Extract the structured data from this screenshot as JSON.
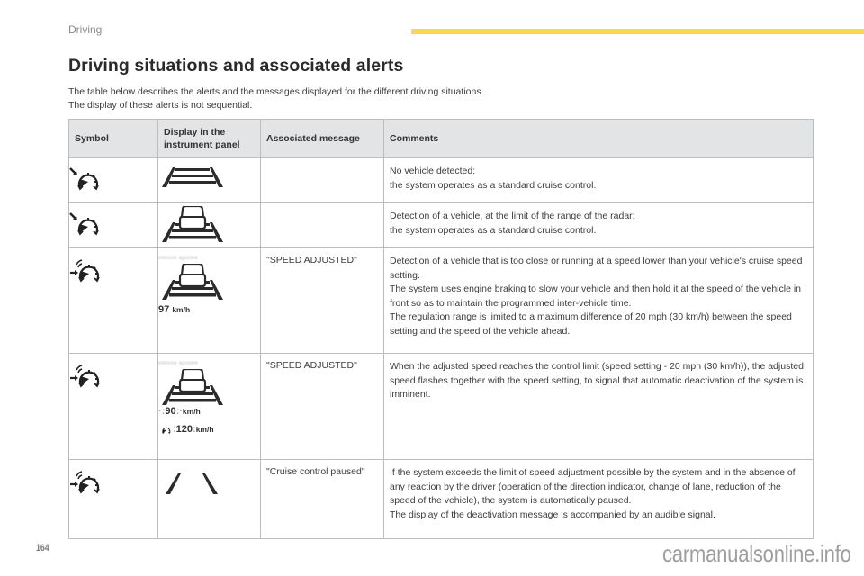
{
  "header": {
    "section": "Driving",
    "accent_color": "#ffd54f"
  },
  "title": "Driving situations and associated alerts",
  "intro": [
    "The table below describes the alerts and the messages displayed for the different driving situations.",
    "The display of these alerts is not sequential."
  ],
  "table": {
    "columns": [
      "Symbol",
      "Display in the instrument panel",
      "Associated message",
      "Comments"
    ],
    "header_bg": "#e3e4e6",
    "rows": [
      {
        "symbol_icon": "cruise-control-standard-icon",
        "display_icon": "road-lanes-icon",
        "display_text": "",
        "display_speed": "",
        "message": "",
        "comments": [
          "No vehicle detected:",
          "the system operates as a standard cruise control."
        ]
      },
      {
        "symbol_icon": "cruise-control-standard-icon",
        "display_icon": "road-lanes-vehicle-icon",
        "display_text": "",
        "display_speed": "",
        "message": "",
        "comments": [
          "Detection of a vehicle, at the limit of the range of the radar:",
          "the system operates as a standard cruise control."
        ]
      },
      {
        "symbol_icon": "adaptive-cruise-control-icon",
        "display_icon": "road-lanes-vehicle-icon",
        "display_text": "vitesse ajustée",
        "display_speed": "97",
        "display_unit": "km/h",
        "message": "\"SPEED ADJUSTED\"",
        "comments": [
          "Detection of a vehicle that is too close or running at a speed lower than your vehicle's cruise speed setting.",
          "The system uses engine braking to slow your vehicle and then hold it at the speed of the vehicle in front so as to maintain the programmed inter-vehicle time.",
          "The regulation range is limited to a maximum difference of 20 mph (30 km/h) between the speed setting and the speed of the vehicle ahead."
        ]
      },
      {
        "symbol_icon": "adaptive-cruise-control-icon",
        "display_icon": "road-lanes-vehicle-icon",
        "display_text": "vitesse ajustée",
        "display_speed": "90",
        "display_unit": "km/h",
        "display_setting_speed": "120",
        "message": "\"SPEED ADJUSTED\"",
        "comments": [
          "When the adjusted speed reaches the control limit (speed setting - 20 mph (30 km/h)), the adjusted speed flashes together with the speed setting, to signal that automatic deactivation of the system is imminent."
        ]
      },
      {
        "symbol_icon": "adaptive-cruise-control-icon",
        "display_icon": "lane-lines-icon",
        "display_text": "",
        "display_speed": "",
        "message": "\"Cruise control paused\"",
        "comments": [
          "If the system exceeds the limit of speed adjustment possible by the system and in the absence of any reaction by the driver (operation of the direction indicator, change of lane, reduction of the speed of the vehicle), the system is automatically paused.",
          "The display of the deactivation message is accompanied by an audible signal."
        ]
      }
    ]
  },
  "footer": {
    "page_number": "164",
    "watermark": "carmanualsonline.info"
  }
}
